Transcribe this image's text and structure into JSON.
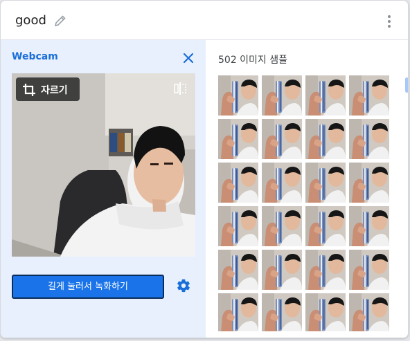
{
  "header": {
    "title": "good"
  },
  "webcam": {
    "label": "Webcam",
    "crop_label": "자르기",
    "record_label": "길게 눌러서 녹화하기"
  },
  "samples": {
    "title": "502 이미지 샘플",
    "thumb_count": 24
  },
  "icons": {
    "edit": "pencil-icon",
    "menu": "more-vert-icon",
    "close": "close-icon",
    "crop": "crop-icon",
    "flip": "flip-icon",
    "settings": "gear-icon"
  },
  "colors": {
    "accent": "#1a73e8",
    "panel": "#e8f0fe",
    "label": "#1a6ed8"
  }
}
